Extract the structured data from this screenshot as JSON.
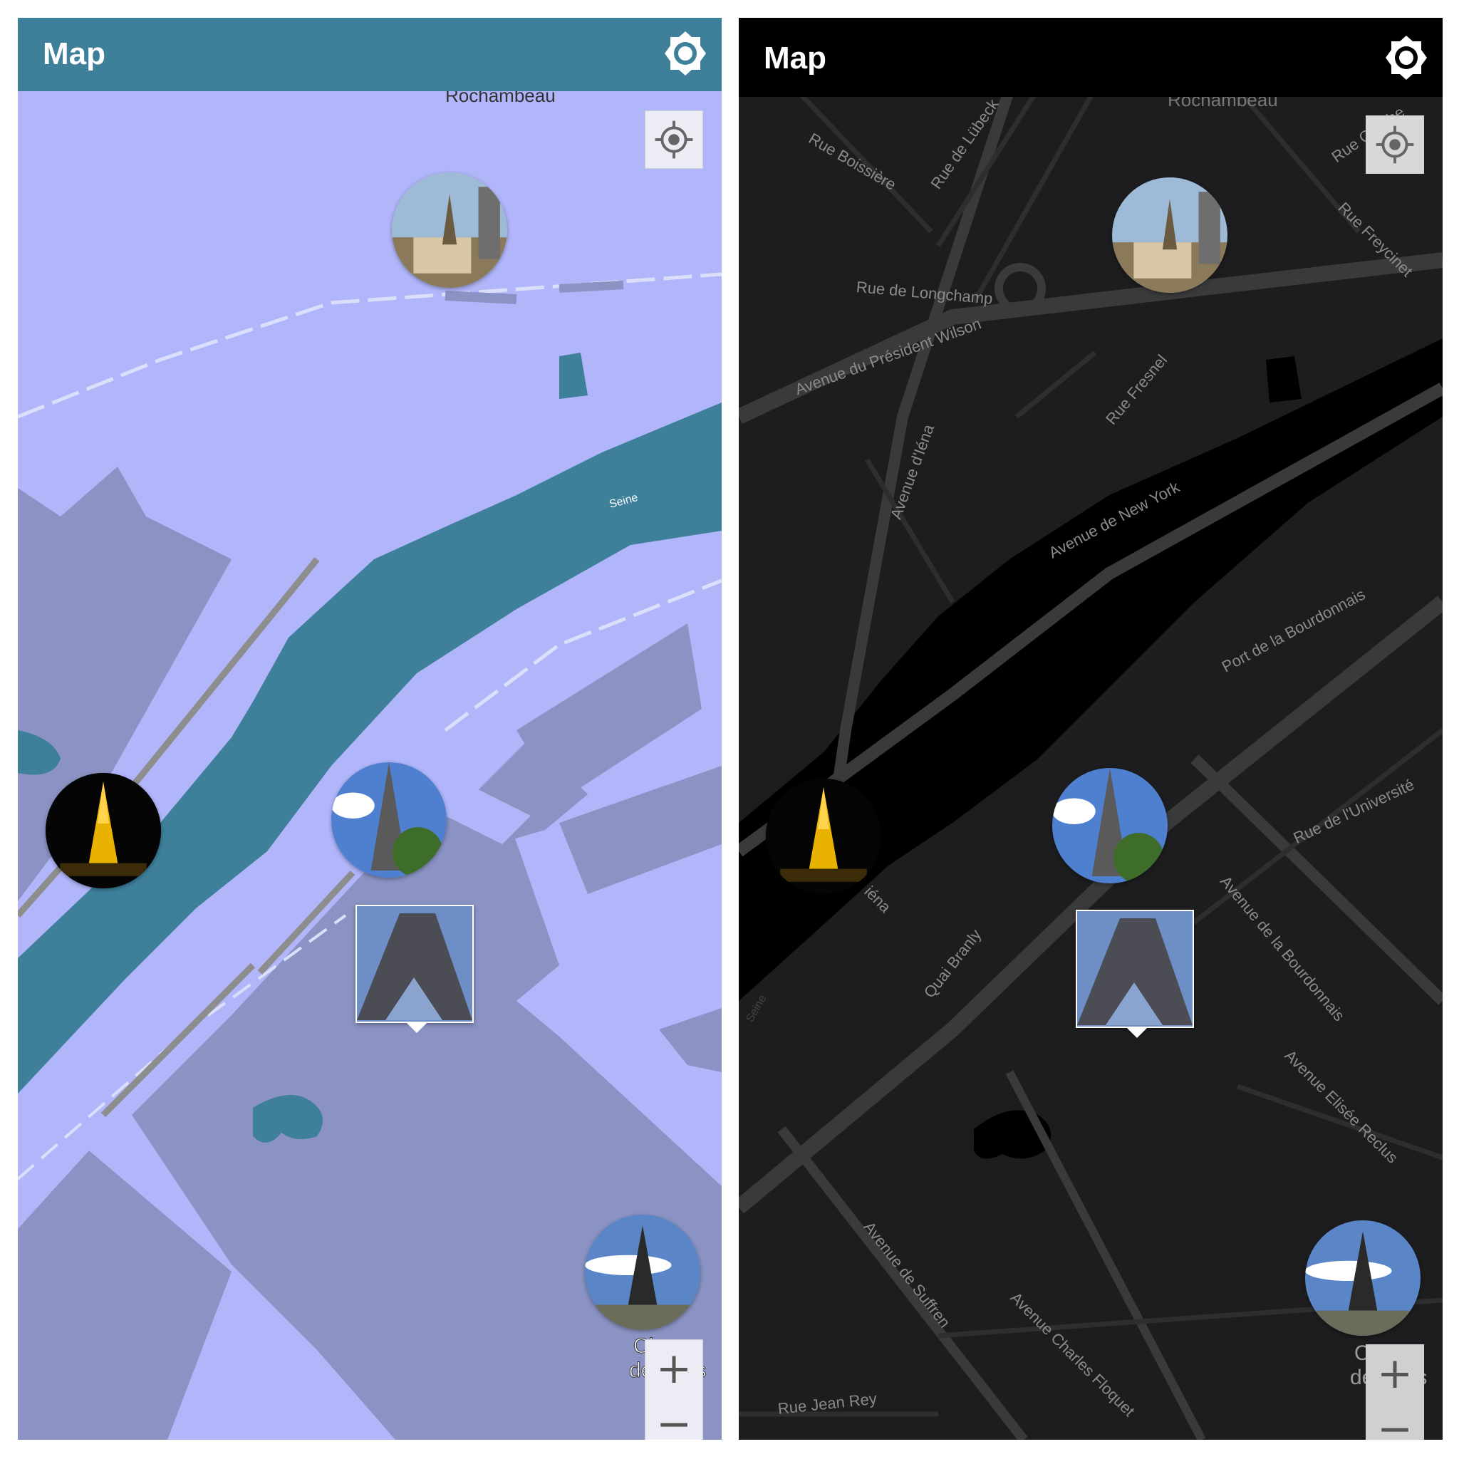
{
  "panels": [
    {
      "theme": "light",
      "appbar": {
        "title": "Map",
        "brightness_icon": "brightness-icon"
      },
      "labels": {
        "top_area": "Rochambeau",
        "river": "Seine",
        "poi_line1": "Champ",
        "poi_line2": "de Mars"
      },
      "controls": {
        "locate_icon": "my-location-icon",
        "zoom_in": "+",
        "zoom_out": "−"
      },
      "colors": {
        "appbar": "#3e7f9a",
        "land": "#b1b6fb",
        "blocks": "#8a93c3",
        "water": "#3e7f9a"
      }
    },
    {
      "theme": "dark",
      "appbar": {
        "title": "Map",
        "brightness_icon": "brightness-icon"
      },
      "labels": {
        "top_area": "Rochambeau",
        "river": "Seine",
        "poi_line1": "Champ",
        "poi_line2": "de Mars",
        "roads": [
          "Rue Boissière",
          "Rue de Lübeck",
          "Rue Goethe",
          "Rue Freycinet",
          "Rue de Longchamp",
          "Avenue du Président Wilson",
          "Rue Fresnel",
          "Avenue d'Iéna",
          "Avenue de New York",
          "Port de la Bourdonnais",
          "Rue de l'Université",
          "Avenue de la Bourdonnais",
          "Avenue Elisée Reclus",
          "Quai Branly",
          "Avenue de Suffren",
          "Avenue Charles Floquet",
          "Rue Jean Rey",
          "iéna"
        ]
      },
      "controls": {
        "locate_icon": "my-location-icon",
        "zoom_in": "+",
        "zoom_out": "−"
      },
      "colors": {
        "appbar": "#000000",
        "land": "#1d1d1f",
        "roads": "#3a3a3c",
        "water": "#000000"
      }
    }
  ]
}
